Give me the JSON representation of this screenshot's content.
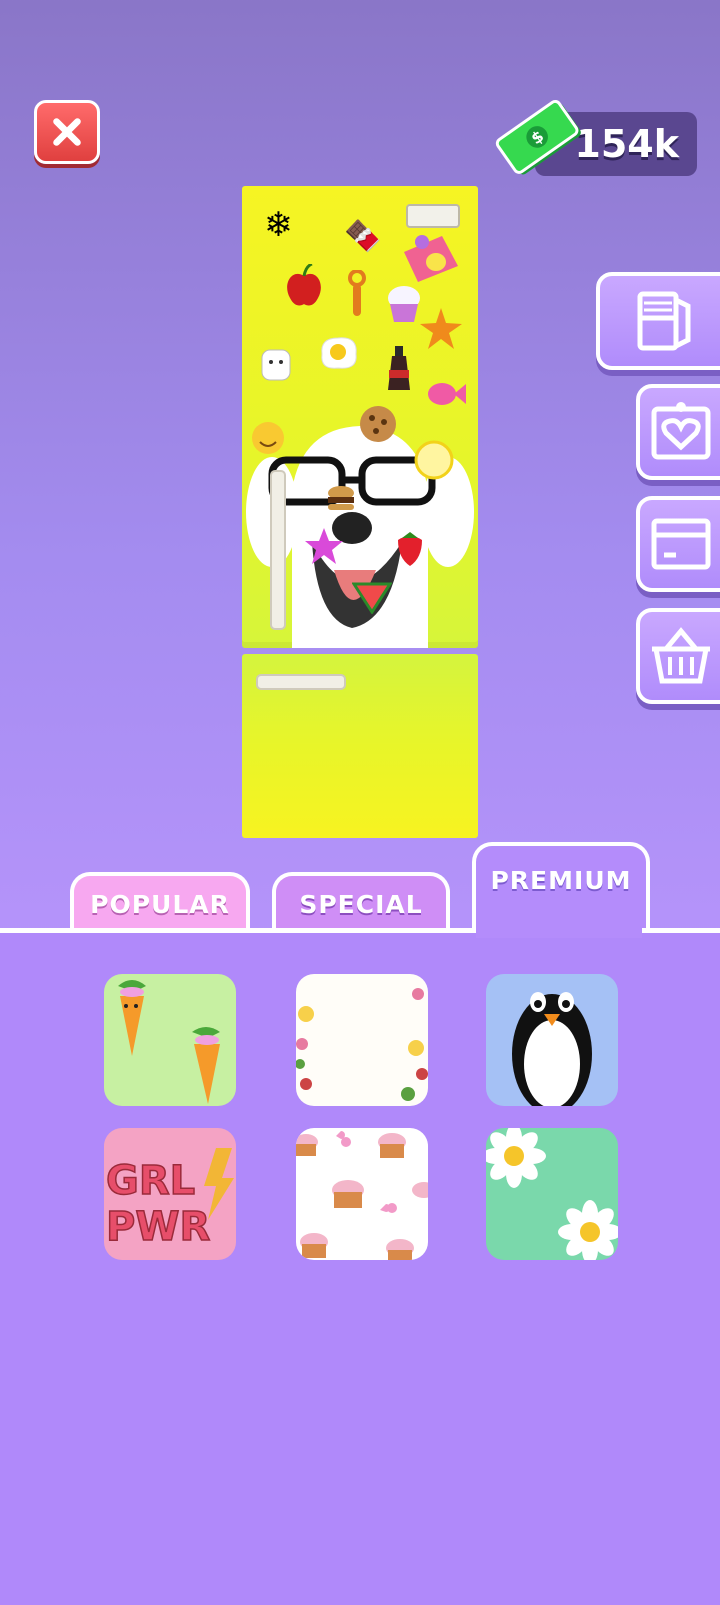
{
  "header": {
    "close_icon": "close-icon",
    "currency": {
      "amount": "154k",
      "icon": "cash-icon"
    }
  },
  "side_tools": [
    {
      "name": "fridge-tool",
      "icon": "fridge-icon"
    },
    {
      "name": "magnet-tool",
      "icon": "heart-note-icon"
    },
    {
      "name": "box-tool",
      "icon": "box-icon"
    },
    {
      "name": "shop-tool",
      "icon": "basket-icon"
    }
  ],
  "tabs": [
    {
      "label": "POPULAR",
      "active": false
    },
    {
      "label": "SPECIAL",
      "active": false
    },
    {
      "label": "PREMIUM",
      "active": true
    }
  ],
  "stickers": [
    {
      "name": "carrot-dancers",
      "icon": "carrot-sticker"
    },
    {
      "name": "flower-frame",
      "icon": "flower-border-sticker"
    },
    {
      "name": "penguin",
      "icon": "penguin-sticker"
    },
    {
      "name": "grl-pwr",
      "icon": "grl-pwr-sticker",
      "text_lines": [
        "GRL",
        "PWR"
      ]
    },
    {
      "name": "cupcakes",
      "icon": "cupcake-pattern-sticker"
    },
    {
      "name": "daisies",
      "icon": "daisy-sticker"
    }
  ],
  "colors": {
    "fridge": "#f3f423",
    "panel": "#b089fa",
    "close": "#e84444",
    "money_pill": "#5a4790"
  }
}
